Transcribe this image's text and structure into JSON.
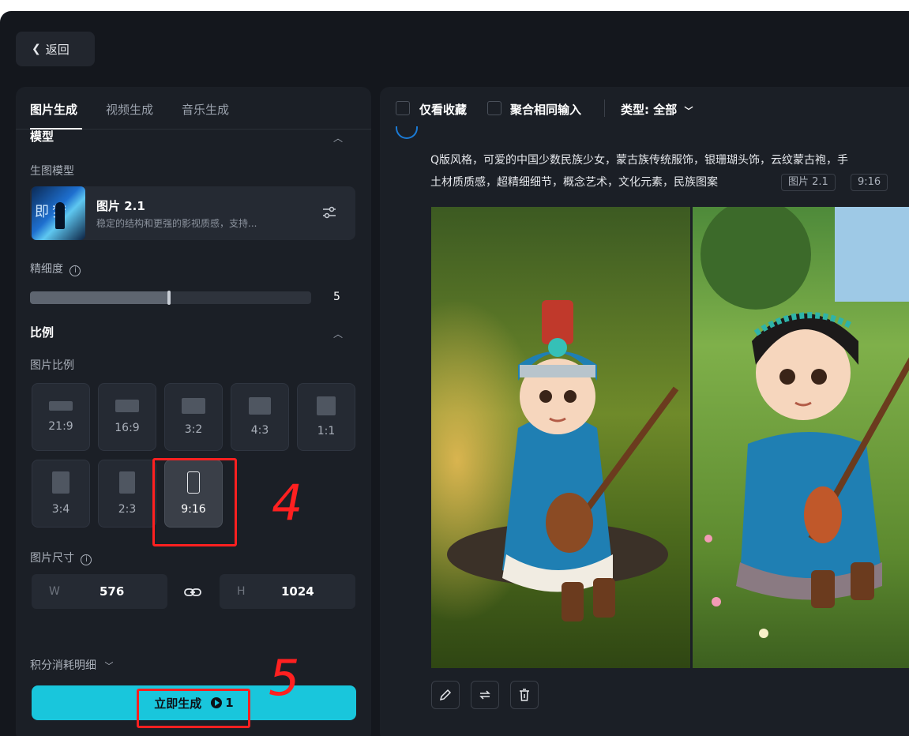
{
  "header": {
    "back_label": "返回"
  },
  "tabs": [
    {
      "label": "图片生成",
      "active": true
    },
    {
      "label": "视频生成",
      "active": false
    },
    {
      "label": "音乐生成",
      "active": false
    }
  ],
  "model_section": {
    "title": "模型",
    "label": "生图模型",
    "model_name": "图片 2.1",
    "model_desc": "稳定的结构和更强的影视质感，支持...",
    "thumb_text": "即梦"
  },
  "detail": {
    "label": "精细度",
    "value": "5",
    "level_fraction": 0.5
  },
  "ratio_section": {
    "title": "比例",
    "label": "图片比例",
    "ratios": [
      {
        "label": "21:9"
      },
      {
        "label": "16:9"
      },
      {
        "label": "3:2"
      },
      {
        "label": "4:3"
      },
      {
        "label": "1:1"
      },
      {
        "label": "3:4"
      },
      {
        "label": "2:3"
      },
      {
        "label": "9:16",
        "selected": true
      }
    ]
  },
  "size_section": {
    "label": "图片尺寸",
    "width_prefix": "W",
    "width_value": "576",
    "height_prefix": "H",
    "height_value": "1024"
  },
  "cost_detail_label": "积分消耗明细",
  "generate": {
    "label": "立即生成",
    "cost": "1"
  },
  "filters": {
    "only_favorites": "仅看收藏",
    "merge_same_input": "聚合相同输入",
    "type_label": "类型: 全部"
  },
  "prompt": {
    "line1": "Q版风格，可爱的中国少数民族少女，蒙古族传统服饰，银珊瑚头饰，云纹蒙古袍，手",
    "line2": "土材质质感，超精细细节，概念艺术，文化元素，民族图案",
    "tags": [
      "图片 2.1",
      "9:16"
    ]
  },
  "annotations": {
    "four": "4",
    "five": "5"
  },
  "colors": {
    "accent": "#19c6dc",
    "annotation": "#ff2020",
    "background": "#14171d",
    "panel": "#1b1f26"
  }
}
